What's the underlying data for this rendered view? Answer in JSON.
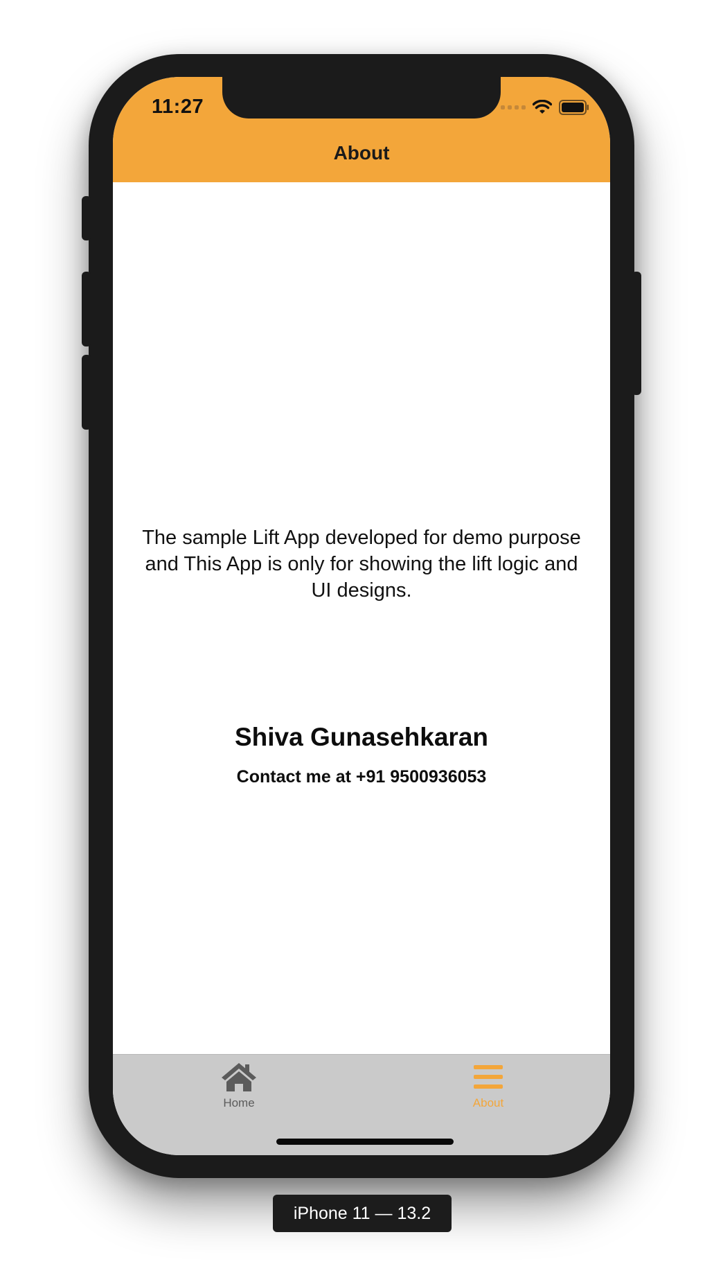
{
  "status_bar": {
    "time": "11:27",
    "signal_icon": "cellular-signal-icon",
    "wifi_icon": "wifi-icon",
    "battery_icon": "battery-icon"
  },
  "nav_bar": {
    "title": "About",
    "background_color": "#F3A63A"
  },
  "content": {
    "description": "The sample Lift App developed for demo purpose and This App is only for showing the lift logic and UI designs.",
    "author_name": "Shiva Gunasehkaran",
    "contact": "Contact me at +91 9500936053"
  },
  "tab_bar": {
    "tabs": [
      {
        "label": "Home",
        "icon": "home-icon",
        "selected": false
      },
      {
        "label": "About",
        "icon": "hamburger-menu-icon",
        "selected": true
      }
    ],
    "active_color": "#F3A63A",
    "inactive_color": "#5b5b5b"
  },
  "device_label": "iPhone 11 — 13.2"
}
